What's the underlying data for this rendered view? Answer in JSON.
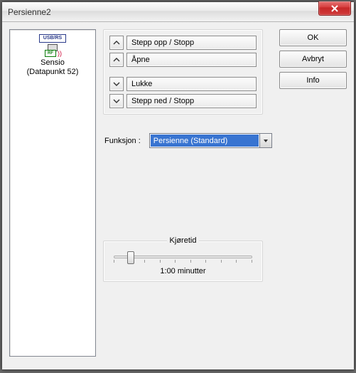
{
  "window": {
    "title": "Persienne2"
  },
  "device": {
    "usb_label": "USB/RS",
    "rf_label": "RF",
    "name": "Sensio",
    "sub": "(Datapunkt 52)"
  },
  "actions": {
    "step_up": "Stepp opp / Stopp",
    "open": "Åpne",
    "close": "Lukke",
    "step_down": "Stepp ned / Stopp"
  },
  "buttons": {
    "ok": "OK",
    "cancel": "Avbryt",
    "info": "Info"
  },
  "function": {
    "label": "Funksjon :",
    "selected": "Persienne (Standard)"
  },
  "runtime": {
    "legend": "Kjøretid",
    "value": "1:00 minutter"
  }
}
